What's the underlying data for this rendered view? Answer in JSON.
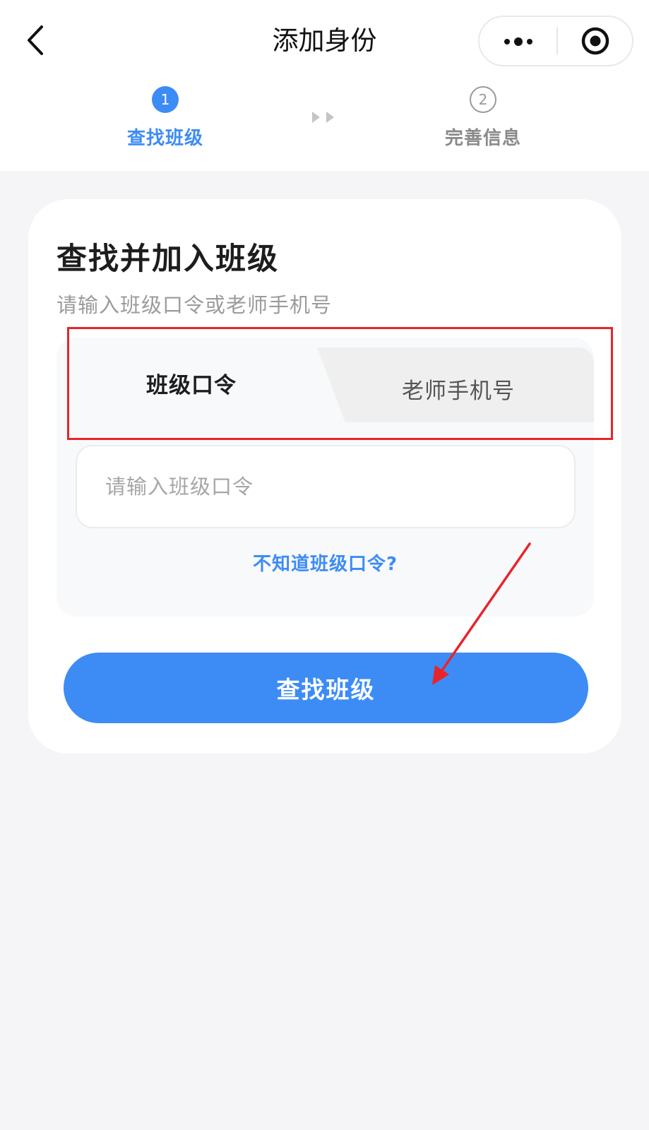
{
  "header": {
    "title": "添加身份",
    "back_icon": "chevron-left-icon",
    "more_icon": "more-dots-icon",
    "close_icon": "target-close-icon"
  },
  "steps": [
    {
      "number": "1",
      "label": "查找班级",
      "state": "active"
    },
    {
      "number": "2",
      "label": "完善信息",
      "state": "inactive"
    }
  ],
  "card": {
    "title": "查找并加入班级",
    "subtitle": "请输入班级口令或老师手机号",
    "tabs": [
      {
        "label": "班级口令",
        "selected": true
      },
      {
        "label": "老师手机号",
        "selected": false
      }
    ],
    "input_placeholder": "请输入班级口令",
    "input_value": "",
    "help_link": "不知道班级口令?",
    "submit_label": "查找班级"
  },
  "colors": {
    "accent": "#3d8cf5",
    "annotation": "#e8242b",
    "background": "#f5f5f7"
  }
}
